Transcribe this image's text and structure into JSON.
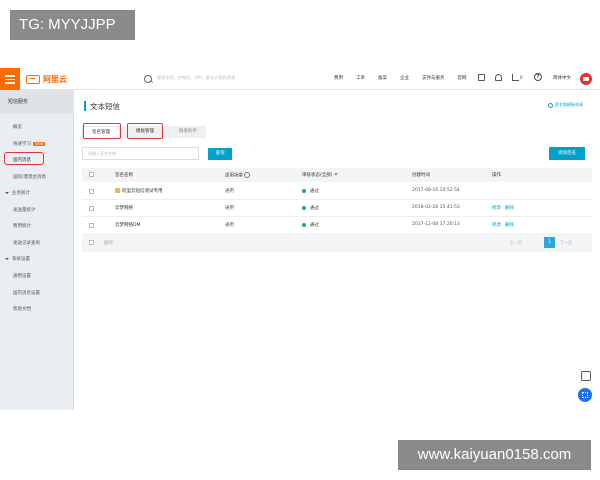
{
  "overlay": {
    "tg": "TG: MYYJJPP",
    "site": "www.kaiyuan0158.com"
  },
  "topbar": {
    "logo_text": "阿里云",
    "search_placeholder": "搜索文档、控制台、API、解决方案和资源",
    "nav": [
      "费用",
      "工单",
      "备案",
      "企业",
      "支持与服务",
      "官网"
    ],
    "cart_count": "0",
    "lang": "简体中文"
  },
  "sidebar": {
    "title": "短信服务",
    "overview": "概览",
    "quickstart": "快速学习",
    "quickstart_badge": "NEW",
    "domestic": "国内消息",
    "intl": "国际/港澳台消息",
    "stats_section": "业务统计",
    "stats_items": [
      "发送量统计",
      "费用统计",
      "发送记录查询"
    ],
    "settings_section": "系统设置",
    "settings_items": [
      "通用设置",
      "国内消息设置"
    ],
    "help": "帮助文档"
  },
  "main": {
    "title": "文本短信",
    "help_link": "签名和模板申请",
    "tabs": [
      "签名管理",
      "模板管理",
      "群发助手"
    ],
    "search_placeholder": "请输入签名名称",
    "query_button": "查询",
    "add_button": "添加签名",
    "columns": [
      "签名名称",
      "适用场景",
      "审核状态(全部)",
      "创建时间",
      "操作"
    ],
    "rows": [
      {
        "name": "阿里云短信测试专用",
        "scene": "通用",
        "status": "通过",
        "time": "2017-08-16 10:52:54",
        "actions": []
      },
      {
        "name": "云梦网络",
        "scene": "通用",
        "status": "通过",
        "time": "2018-02-28 15:41:53",
        "actions": [
          "修改",
          "删除"
        ]
      },
      {
        "name": "云梦网络DM",
        "scene": "通用",
        "status": "通过",
        "time": "2017-12-08 17:20:13",
        "actions": [
          "修改",
          "删除"
        ]
      }
    ],
    "footer_delete": "删除",
    "pagination": {
      "prev": "上一页",
      "current": "1",
      "next": "下一页"
    }
  }
}
